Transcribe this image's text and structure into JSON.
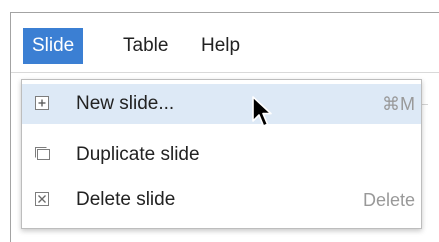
{
  "menubar": {
    "items": [
      {
        "label": "Slide",
        "open": true
      },
      {
        "label": "Table"
      },
      {
        "label": "Help"
      }
    ]
  },
  "dropdown": {
    "items": [
      {
        "label": "New slide...",
        "shortcut": "⌘M",
        "icon": "plus-square-icon",
        "highlighted": true
      },
      {
        "label": "Duplicate slide",
        "shortcut": "",
        "icon": "duplicate-icon"
      },
      {
        "label": "Delete slide",
        "shortcut": "Delete",
        "icon": "x-square-icon"
      }
    ]
  },
  "colors": {
    "menu_open_bg": "#3b7fd3",
    "menu_highlight_bg": "#dde9f6",
    "shortcut_text": "#999999"
  }
}
